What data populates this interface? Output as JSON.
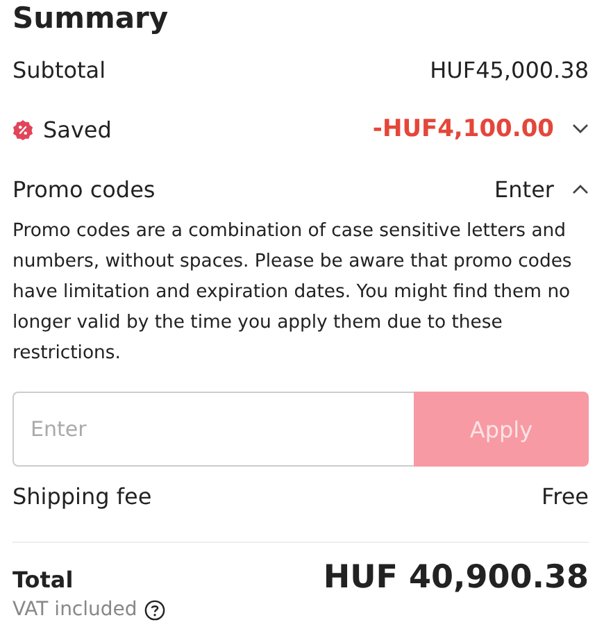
{
  "title": "Summary",
  "subtotal": {
    "label": "Subtotal",
    "value": "HUF45,000.38"
  },
  "saved": {
    "label": "Saved",
    "value": "-HUF4,100.00",
    "expanded": false
  },
  "promo": {
    "label": "Promo codes",
    "action": "Enter",
    "expanded": true,
    "description": "Promo codes are a combination of case sensitive letters and numbers, without spaces. Please be aware that promo codes have limitation and expiration dates. You might find them no longer valid by the time you apply them due to these restrictions.",
    "placeholder": "Enter",
    "button": "Apply",
    "button_disabled": true
  },
  "shipping": {
    "label": "Shipping fee",
    "value": "Free"
  },
  "total": {
    "label": "Total",
    "value": "HUF 40,900.38",
    "note": "VAT included"
  }
}
